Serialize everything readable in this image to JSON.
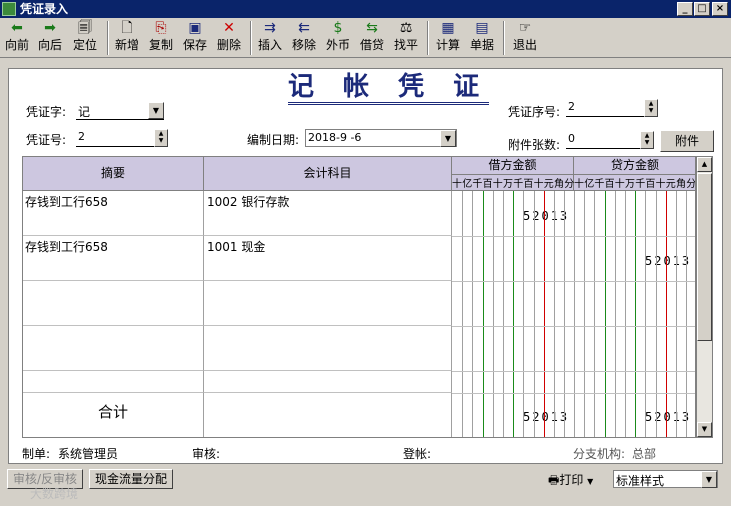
{
  "window": {
    "title": "凭证录入"
  },
  "toolbar": {
    "items": [
      {
        "label": "向前",
        "icon": "arrow-left-icon"
      },
      {
        "label": "向后",
        "icon": "arrow-right-icon"
      },
      {
        "label": "定位",
        "icon": "locate-icon"
      },
      {
        "label": "新增",
        "icon": "new-doc-icon"
      },
      {
        "label": "复制",
        "icon": "copy-icon"
      },
      {
        "label": "保存",
        "icon": "save-icon"
      },
      {
        "label": "删除",
        "icon": "delete-icon"
      },
      {
        "label": "插入",
        "icon": "insert-icon"
      },
      {
        "label": "移除",
        "icon": "remove-icon"
      },
      {
        "label": "外币",
        "icon": "currency-icon"
      },
      {
        "label": "借贷",
        "icon": "debit-credit-icon"
      },
      {
        "label": "找平",
        "icon": "balance-icon"
      },
      {
        "label": "计算",
        "icon": "calculator-icon"
      },
      {
        "label": "单据",
        "icon": "document-icon"
      },
      {
        "label": "退出",
        "icon": "exit-icon"
      }
    ]
  },
  "voucher": {
    "title": "记 帐 凭 证",
    "type_label": "凭证字:",
    "type_value": "记",
    "no_label": "凭证号:",
    "no_value": "2",
    "date_label": "编制日期:",
    "date_value": "2018-9 -6",
    "seq_label": "凭证序号:",
    "seq_value": "2",
    "attach_label": "附件张数:",
    "attach_value": "0",
    "attach_button": "附件"
  },
  "grid": {
    "headers": {
      "summary": "摘要",
      "account": "会计科目",
      "debit": "借方金额",
      "credit": "贷方金额"
    },
    "digits": [
      "十",
      "亿",
      "千",
      "百",
      "十",
      "万",
      "千",
      "百",
      "十",
      "元",
      "角",
      "分"
    ],
    "rows": [
      {
        "summary": "存钱到工行658",
        "account": "1002 银行存款",
        "debit": "52013",
        "credit": ""
      },
      {
        "summary": "存钱到工行658",
        "account": "1001 现金",
        "debit": "",
        "credit": "52013"
      }
    ],
    "total": {
      "label": "合计",
      "debit": "52013",
      "credit": "52013"
    }
  },
  "footer": {
    "maker_label": "制单:",
    "maker_value": "系统管理员",
    "audit_label": "审核:",
    "post_label": "登帐:",
    "branch_label": "分支机构:",
    "branch_value": "总部"
  },
  "bottom": {
    "audit_button": "审核/反审核",
    "cashflow_button": "现金流量分配",
    "print_label": "打印",
    "style_value": "标准样式",
    "watermark": "大数跨境"
  }
}
